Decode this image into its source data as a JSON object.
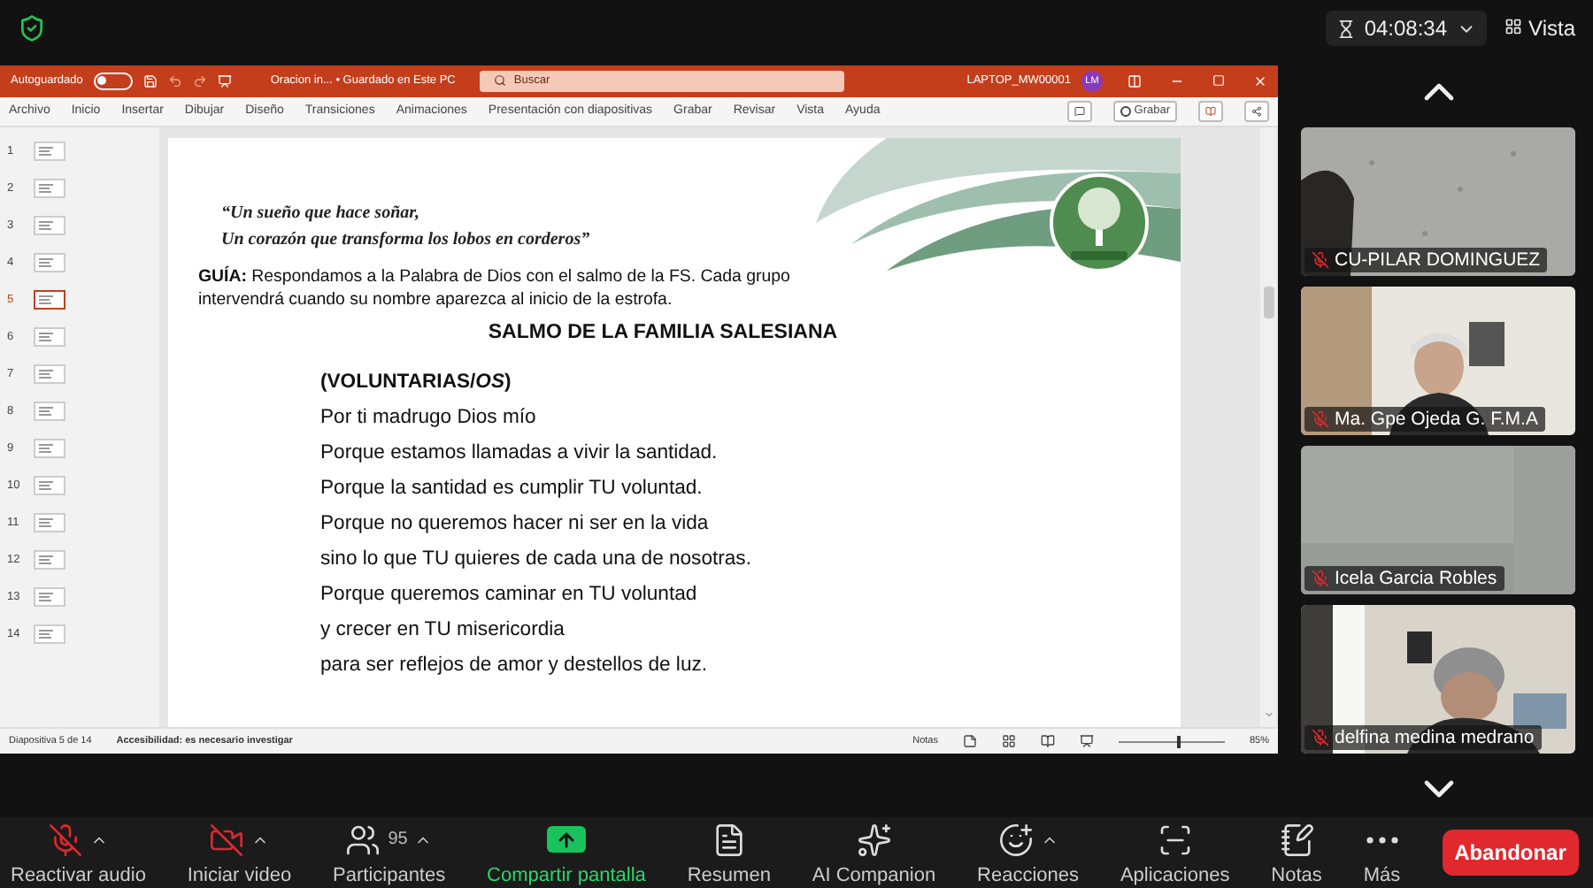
{
  "meeting": {
    "timer": "04:08:34",
    "view_label": "Vista"
  },
  "powerpoint": {
    "autosave": {
      "label": "Autoguardado",
      "on": false
    },
    "document_title": "Oracion in... • Guardado en Este PC",
    "search": {
      "placeholder": "Buscar"
    },
    "account": "LAPTOP_MW00001",
    "avatar": "LM",
    "ribbon_tabs": [
      "Archivo",
      "Inicio",
      "Insertar",
      "Dibujar",
      "Diseño",
      "Transiciones",
      "Animaciones",
      "Presentación con diapositivas",
      "Grabar",
      "Revisar",
      "Vista",
      "Ayuda"
    ],
    "record_button": "Grabar",
    "thumbnails": [
      {
        "number": "1",
        "selected": false
      },
      {
        "number": "2",
        "selected": false
      },
      {
        "number": "3",
        "selected": false
      },
      {
        "number": "4",
        "selected": false
      },
      {
        "number": "5",
        "selected": true
      },
      {
        "number": "6",
        "selected": false
      },
      {
        "number": "7",
        "selected": false
      },
      {
        "number": "8",
        "selected": false
      },
      {
        "number": "9",
        "selected": false
      },
      {
        "number": "10",
        "selected": false
      },
      {
        "number": "11",
        "selected": false
      },
      {
        "number": "12",
        "selected": false
      },
      {
        "number": "13",
        "selected": false
      },
      {
        "number": "14",
        "selected": false
      }
    ],
    "slide": {
      "quote_lines": [
        "“Un sueño que hace soñar,",
        "Un corazón que transforma los lobos en corderos”"
      ],
      "guide": "**GUÍA:** Respondamos a la Palabra de Dios con el salmo de la FS. Cada grupo intervendrá cuando su nombre aparezca al inicio de la estrofa.",
      "heading": "SALMO DE LA FAMILIA SALESIANA",
      "psalm_lines": [
        {
          "kind": "group",
          "text": "(VOLUNTARIAS/*OS*)"
        },
        {
          "kind": "verse",
          "text": "Por ti madrugo Dios mío"
        },
        {
          "kind": "verse",
          "text": "Porque estamos llamadas a vivir la santidad."
        },
        {
          "kind": "verse",
          "text": "Porque la santidad es cumplir TU voluntad."
        },
        {
          "kind": "verse",
          "text": "Porque no queremos hacer ni ser en la vida"
        },
        {
          "kind": "verse",
          "text": "sino lo que TU quieres de cada una de nosotras."
        },
        {
          "kind": "verse",
          "text": "Porque queremos caminar en TU voluntad"
        },
        {
          "kind": "verse",
          "text": "y crecer en TU misericordia"
        },
        {
          "kind": "verse",
          "text": "para ser reflejos de amor y destellos de luz."
        }
      ]
    },
    "status": {
      "slide_counter": "Diapositiva 5 de 14",
      "accessibility": "Accesibilidad: es necesario investigar",
      "notes": "Notas",
      "zoom": {
        "level": 0.55
      },
      "zoom_reading": "85%"
    }
  },
  "participants": [
    {
      "name": "CU-PILAR DOMINGUEZ",
      "muted": true
    },
    {
      "name": "Ma. Gpe Ojeda G. F.M.A",
      "muted": true
    },
    {
      "name": "Icela Garcia Robles",
      "muted": true
    },
    {
      "name": "delfina medina medrano",
      "muted": true
    }
  ],
  "toolbar": [
    {
      "kind": "mic",
      "label": "Reactivar audio",
      "caret": true
    },
    {
      "kind": "video",
      "label": "Iniciar video",
      "caret": true
    },
    {
      "kind": "participants",
      "label": "Participantes",
      "count": "95",
      "caret": true
    },
    {
      "kind": "share",
      "label": "Compartir pantalla",
      "caret": false
    },
    {
      "kind": "summary",
      "label": "Resumen",
      "caret": false
    },
    {
      "kind": "companion",
      "label": "AI Companion",
      "caret": false
    },
    {
      "kind": "reactions",
      "label": "Reacciones",
      "caret": true
    },
    {
      "kind": "apps",
      "label": "Aplicaciones",
      "caret": false
    },
    {
      "kind": "notes",
      "label": "Notas",
      "caret": false
    },
    {
      "kind": "more",
      "label": "Más",
      "caret": false
    }
  ],
  "leave_button": "Abandonar"
}
